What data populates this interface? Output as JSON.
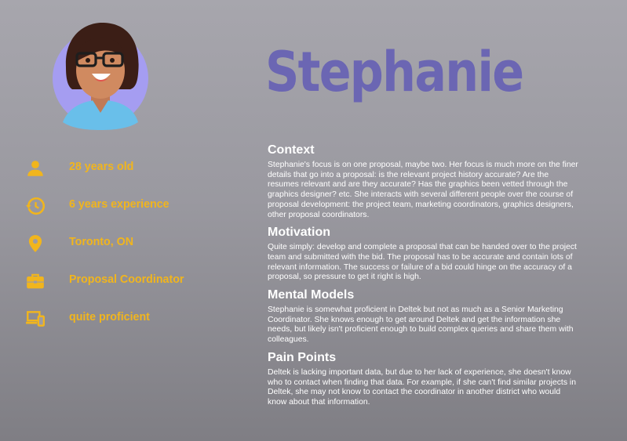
{
  "persona": {
    "name": "Stephanie",
    "avatar_icon": "avatar-illustration"
  },
  "facts": [
    {
      "icon": "person-icon",
      "text": "28 years old"
    },
    {
      "icon": "history-icon",
      "text": "6 years experience"
    },
    {
      "icon": "location-pin-icon",
      "text": "Toronto, ON"
    },
    {
      "icon": "briefcase-icon",
      "text": "Proposal Coordinator"
    },
    {
      "icon": "devices-icon",
      "text": "quite proficient"
    }
  ],
  "sections": [
    {
      "heading": "Context",
      "body": "Stephanie's focus is on one proposal, maybe two. Her focus is much more on the finer details that go into a proposal: is the relevant project history accurate? Are the resumes relevant and are they accurate? Has the graphics been vetted through the graphics designer? etc. She interacts with several different people over the course of proposal development: the project team, marketing coordinators, graphics designers, other proposal coordinators."
    },
    {
      "heading": "Motivation",
      "body": "Quite simply: develop and complete a proposal that can be handed over to the project team and submitted with the bid. The proposal has to be accurate and contain lots of relevant information. The success or failure of a bid could hinge on the accuracy of a proposal, so pressure to get it right is high."
    },
    {
      "heading": "Mental Models",
      "body": "Stephanie is somewhat proficient in Deltek but not as much as a Senior Marketing Coordinator. She knows enough to get around Deltek and get the information she needs, but likely isn't proficient enough to build complex queries and share them with colleagues."
    },
    {
      "heading": "Pain Points",
      "body": "Deltek is lacking important data, but due to her lack of experience, she doesn't know who to contact when finding that data. For example, if she can't find similar projects in Deltek, she may not know to contact the coordinator in another district who would know about that information."
    }
  ],
  "colors": {
    "accent": "#f1b51d",
    "name": "#6b66b3",
    "text": "#ffffff"
  }
}
